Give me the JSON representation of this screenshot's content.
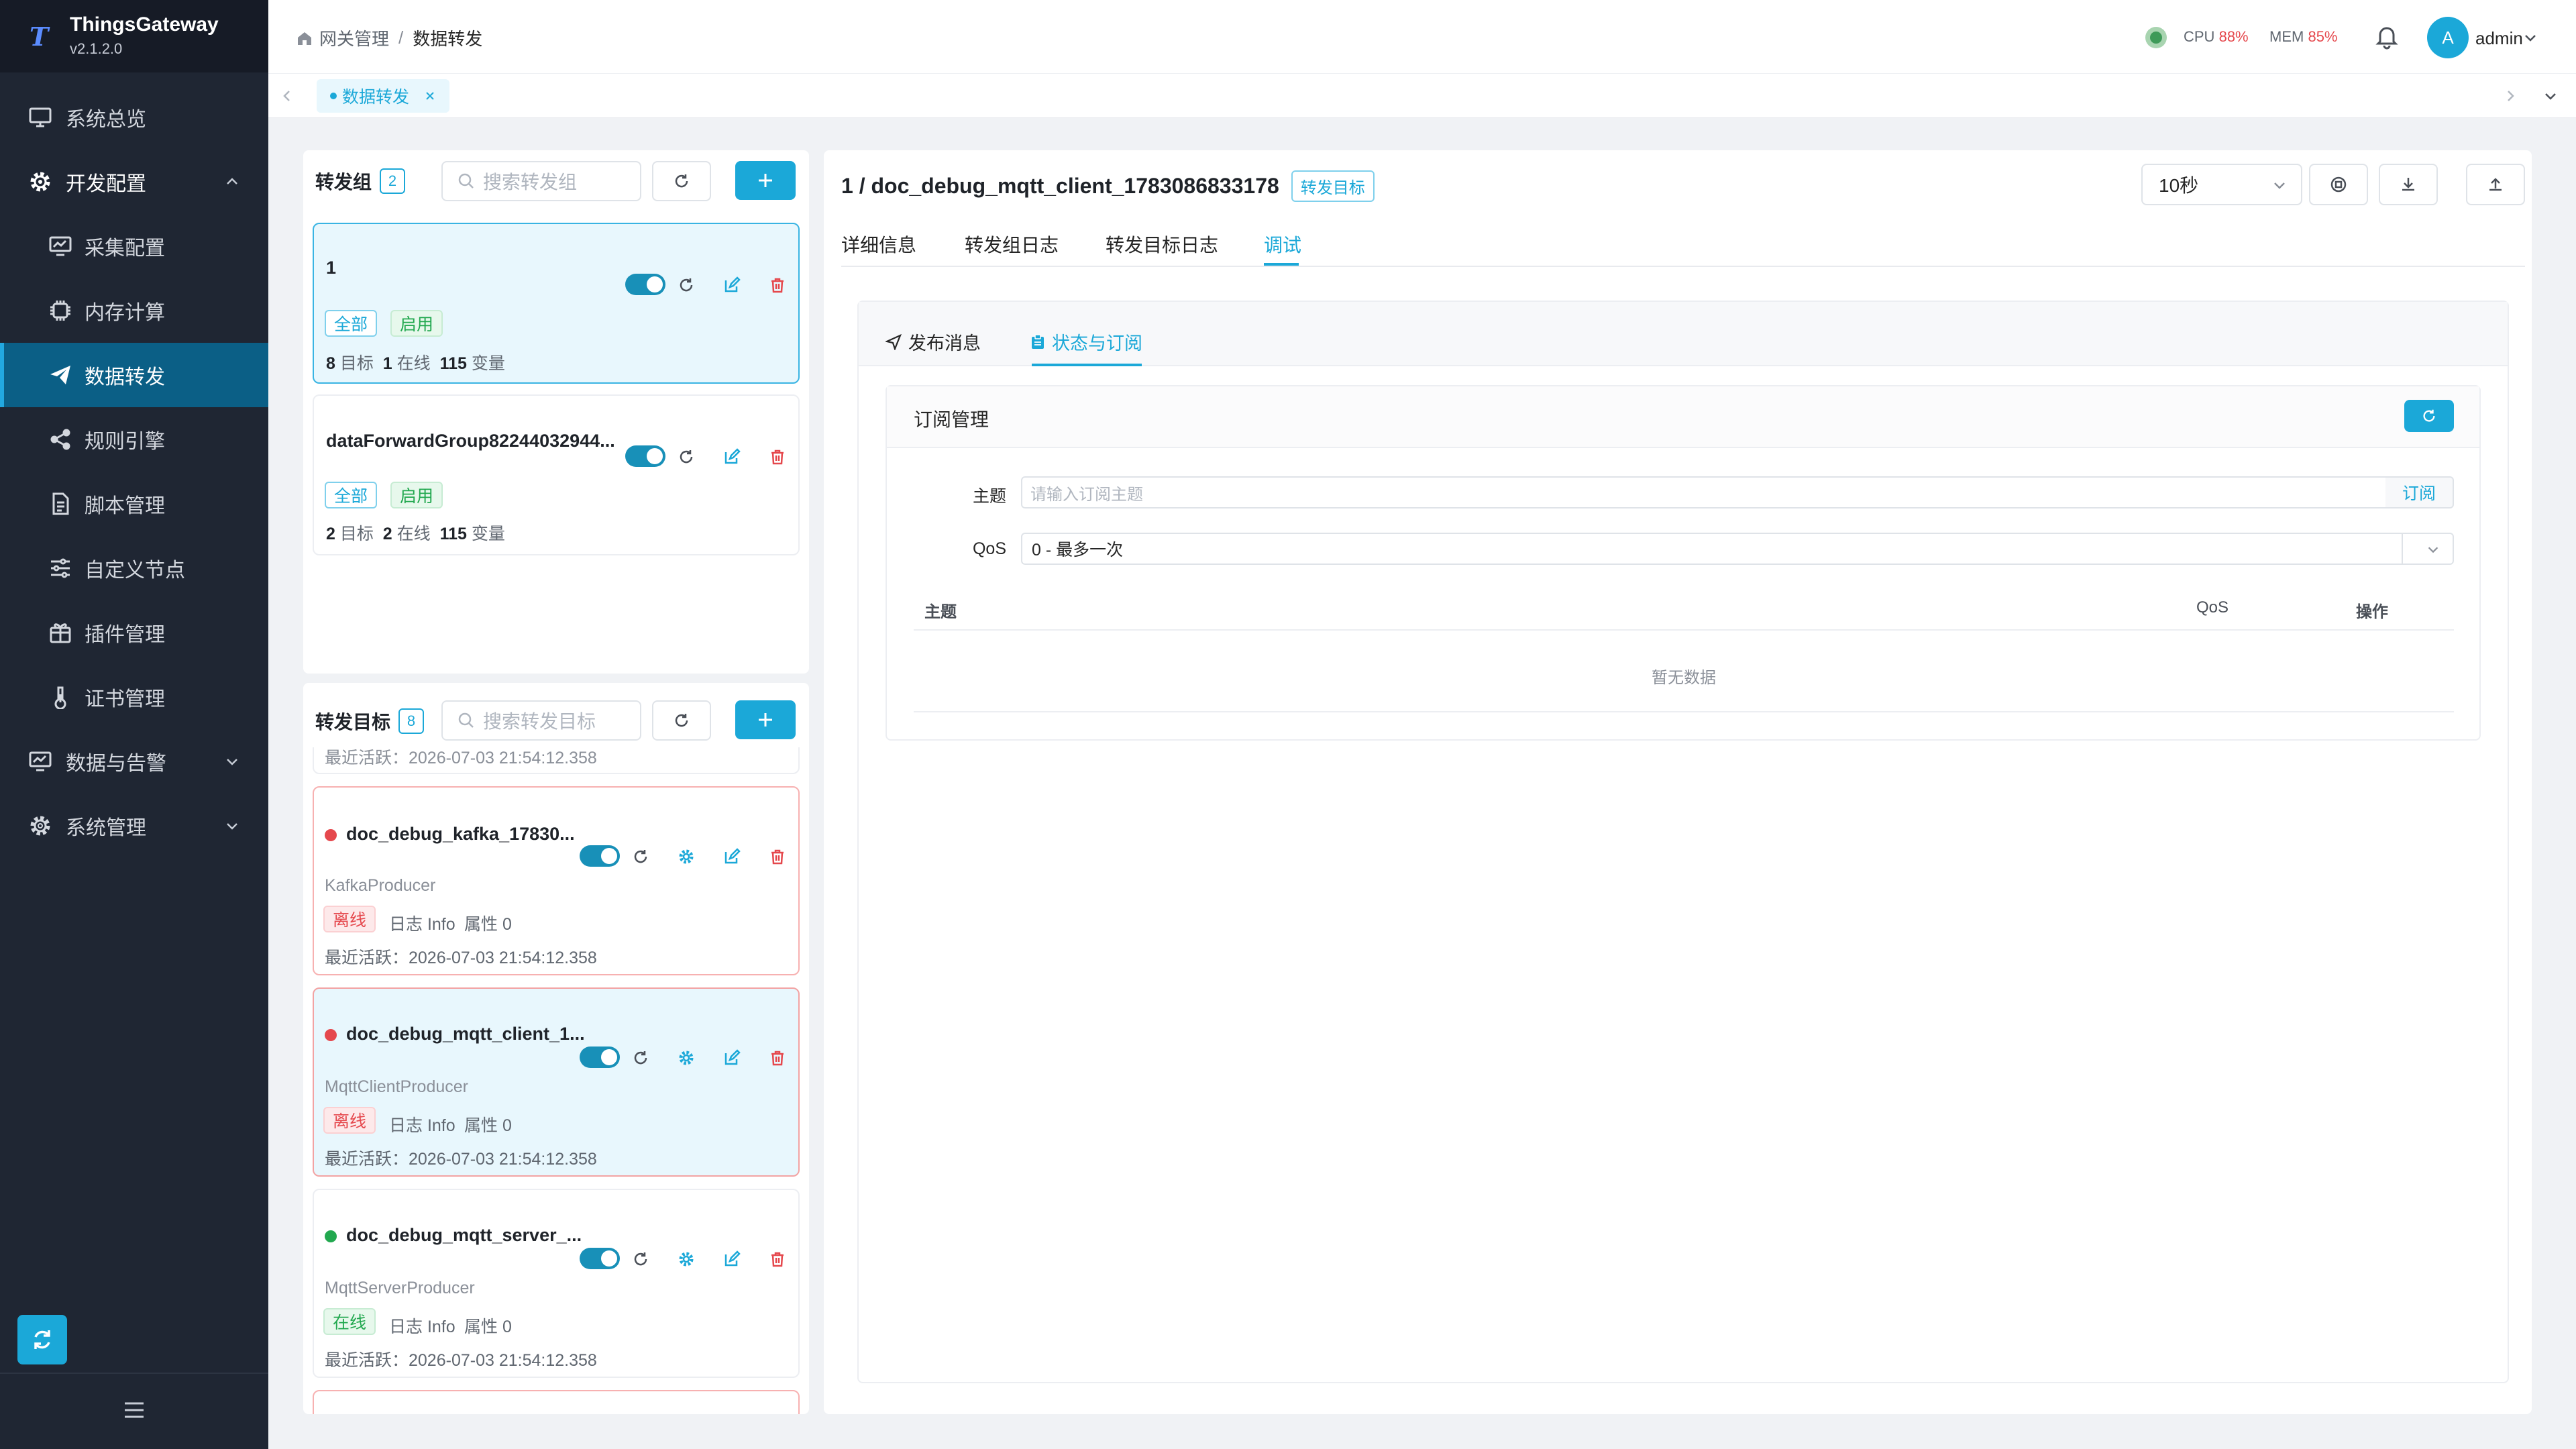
{
  "app": {
    "name": "ThingsGateway",
    "version": "v2.1.2.0"
  },
  "sidebar": {
    "items": [
      {
        "label": "系统总览",
        "icon": "monitor-icon"
      },
      {
        "label": "开发配置",
        "icon": "gear-icon",
        "expanded": true
      },
      {
        "label": "采集配置",
        "icon": "chart-monitor-icon"
      },
      {
        "label": "内存计算",
        "icon": "chip-icon"
      },
      {
        "label": "数据转发",
        "icon": "paper-plane-icon",
        "active": true
      },
      {
        "label": "规则引擎",
        "icon": "share-nodes-icon"
      },
      {
        "label": "脚本管理",
        "icon": "document-icon"
      },
      {
        "label": "自定义节点",
        "icon": "sliders-icon"
      },
      {
        "label": "插件管理",
        "icon": "gift-box-icon"
      },
      {
        "label": "证书管理",
        "icon": "thermometer-icon"
      },
      {
        "label": "数据与告警",
        "icon": "monitor-icon"
      },
      {
        "label": "系统管理",
        "icon": "gear-icon"
      }
    ]
  },
  "header": {
    "breadcrumb": [
      "网关管理",
      "数据转发"
    ],
    "cpu_label": "CPU",
    "cpu_value": "88%",
    "mem_label": "MEM",
    "mem_value": "85%",
    "user": "admin",
    "avatar_letter": "A"
  },
  "tabs": {
    "open": [
      {
        "label": "数据转发"
      }
    ]
  },
  "groups": {
    "title": "转发组",
    "count": "2",
    "search_placeholder": "搜索转发组",
    "items": [
      {
        "name": "1",
        "tag_scope": "全部",
        "tag_status": "启用",
        "targets": "8",
        "targets_label": "目标",
        "online": "1",
        "online_label": "在线",
        "vars": "115",
        "vars_label": "变量",
        "selected": true
      },
      {
        "name": "dataForwardGroup82244032944...",
        "tag_scope": "全部",
        "tag_status": "启用",
        "targets": "2",
        "targets_label": "目标",
        "online": "2",
        "online_label": "在线",
        "vars": "115",
        "vars_label": "变量",
        "selected": false
      }
    ]
  },
  "targets": {
    "title": "转发目标",
    "count": "8",
    "search_placeholder": "搜索转发目标",
    "clipped_text": "最近活跃：2026-07-03 21:54:12.358",
    "items": [
      {
        "name": "doc_debug_kafka_17830...",
        "type": "KafkaProducer",
        "status": "离线",
        "log": "日志 Info",
        "attrs": "属性 0",
        "last_active": "最近活跃：2026-07-03 21:54:12.358",
        "online": false,
        "selected": false
      },
      {
        "name": "doc_debug_mqtt_client_1...",
        "type": "MqttClientProducer",
        "status": "离线",
        "log": "日志 Info",
        "attrs": "属性 0",
        "last_active": "最近活跃：2026-07-03 21:54:12.358",
        "online": false,
        "selected": true
      },
      {
        "name": "doc_debug_mqtt_server_...",
        "type": "MqttServerProducer",
        "status": "在线",
        "log": "日志 Info",
        "attrs": "属性 0",
        "last_active": "最近活跃：2026-07-03 21:54:12.358",
        "online": true,
        "selected": false
      }
    ]
  },
  "detail": {
    "title": "1 / doc_debug_mqtt_client_1783086833178",
    "tag": "转发目标",
    "interval": "10秒",
    "tabs": [
      "详细信息",
      "转发组日志",
      "转发目标日志",
      "调试"
    ],
    "active_tab": 3,
    "subtabs": [
      "发布消息",
      "状态与订阅"
    ],
    "active_subtab": 1,
    "subscription": {
      "title": "订阅管理",
      "topic_label": "主题",
      "topic_placeholder": "请输入订阅主题",
      "subscribe_button": "订阅",
      "qos_label": "QoS",
      "qos_value": "0 - 最多一次",
      "columns": [
        "主题",
        "QoS",
        "操作"
      ],
      "empty": "暂无数据"
    }
  },
  "colors": {
    "accent": "#1ba8d8",
    "sidebar": "#1f2633",
    "danger": "#e5484d",
    "success": "#22a84f"
  }
}
